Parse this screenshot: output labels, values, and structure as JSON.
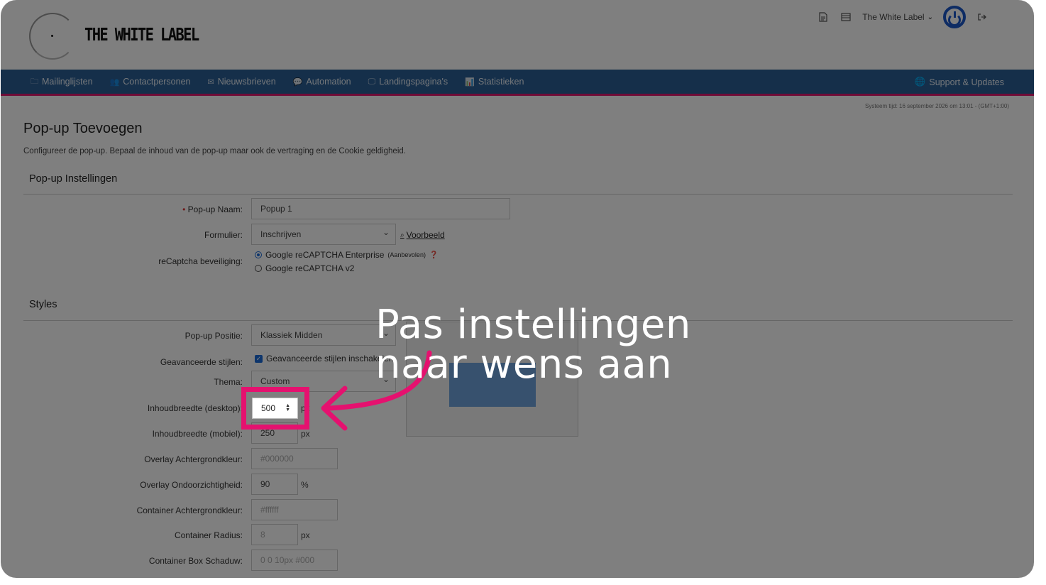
{
  "header": {
    "logo_text": "THE WHITE LABEL",
    "user_menu_label": "The White Label",
    "icons": [
      "document-icon",
      "list-icon",
      "user-caret-icon",
      "power-icon",
      "logout-icon"
    ]
  },
  "nav": {
    "items": [
      {
        "label": "Mailinglijsten",
        "icon": "folder-icon"
      },
      {
        "label": "Contactpersonen",
        "icon": "users-icon"
      },
      {
        "label": "Nieuwsbrieven",
        "icon": "envelope-icon"
      },
      {
        "label": "Automation",
        "icon": "chat-icon"
      },
      {
        "label": "Landingspagina's",
        "icon": "monitor-icon"
      },
      {
        "label": "Statistieken",
        "icon": "chart-icon"
      }
    ],
    "support_label": "Support & Updates",
    "accent_color": "#2b5f94",
    "border_color": "#e0186e"
  },
  "system_time": "Systeem tijd: 16 september 2026 om 13:01 - (GMT+1:00)",
  "page": {
    "title": "Pop-up Toevoegen",
    "description": "Configureer de pop-up. Bepaal de inhoud van de pop-up maar ook de vertraging en de Cookie geldigheid."
  },
  "settings": {
    "section_title": "Pop-up Instellingen",
    "name_label": "Pop-up Naam:",
    "name_value": "Popup 1",
    "form_label": "Formulier:",
    "form_value": "Inschrijven",
    "preview_link": "Voorbeeld",
    "recaptcha_label": "reCaptcha beveiliging:",
    "recaptcha_option_1": "Google reCAPTCHA Enterprise",
    "recaptcha_option_1_note": "(Aanbevolen)",
    "recaptcha_option_2": "Google reCAPTCHA v2"
  },
  "styles": {
    "section_title": "Styles",
    "position_label": "Pop-up Positie:",
    "position_value": "Klassiek Midden",
    "advanced_label": "Geavanceerde stijlen:",
    "advanced_checkbox": "Geavanceerde stijlen inschakelen",
    "theme_label": "Thema:",
    "theme_value": "Custom",
    "width_desktop_label": "Inhoudbreedte (desktop):",
    "width_desktop_value": "500",
    "width_mobile_label": "Inhoudbreedte (mobiel):",
    "width_mobile_value": "250",
    "overlay_bg_label": "Overlay Achtergrondkleur:",
    "overlay_bg_value": "#000000",
    "overlay_opacity_label": "Overlay Ondoorzichtigheid:",
    "overlay_opacity_value": "90",
    "container_bg_label": "Container Achtergrondkleur:",
    "container_bg_value": "#ffffff",
    "container_radius_label": "Container Radius:",
    "container_radius_value": "8",
    "container_shadow_label": "Container Box Schaduw:",
    "container_shadow_value": "0 0 10px #000",
    "unit_px": "px",
    "unit_percent": "%"
  },
  "annotation": {
    "callout_line_1": "Pas instellingen",
    "callout_line_2": "naar wens aan",
    "highlight_color": "#e5116f"
  }
}
